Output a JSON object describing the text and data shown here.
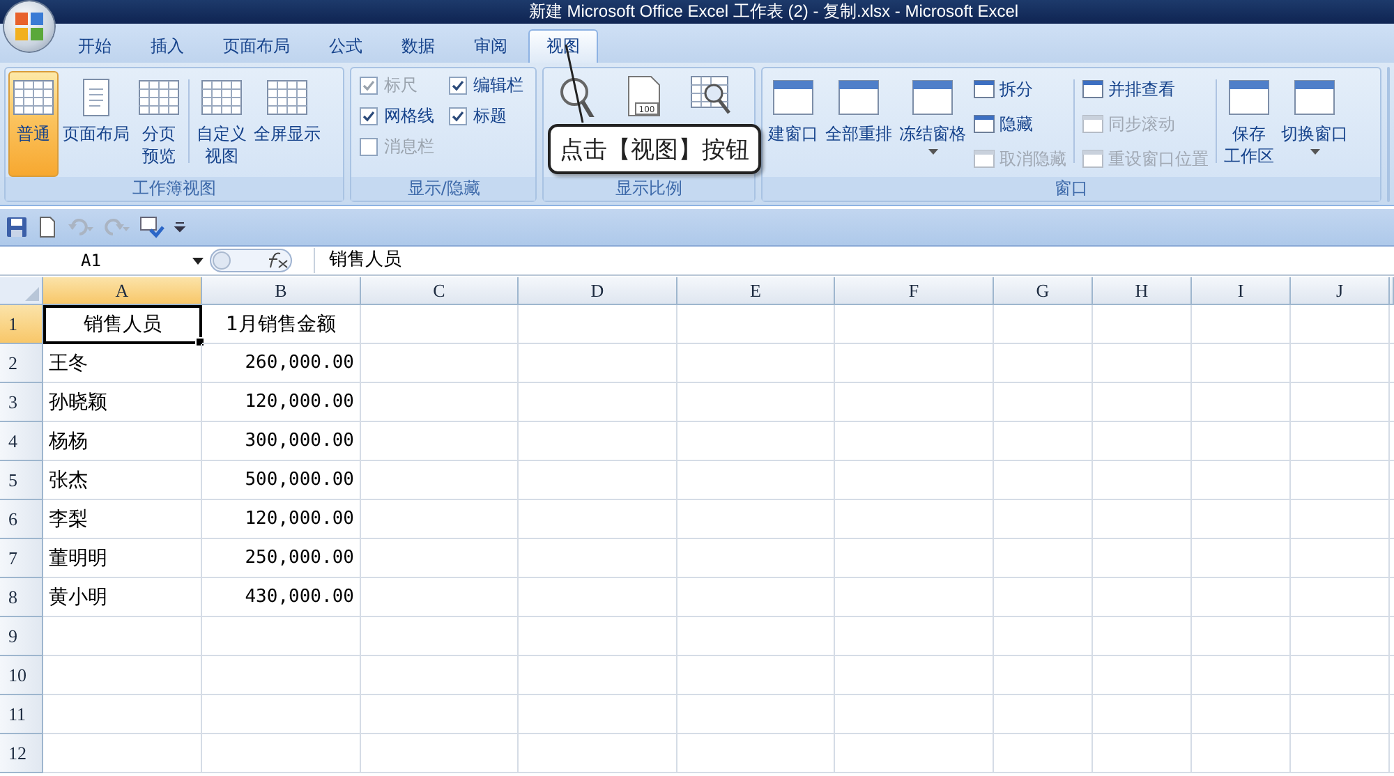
{
  "window": {
    "title": "新建 Microsoft Office Excel 工作表 (2) - 复制.xlsx - Microsoft Excel"
  },
  "tabs": [
    {
      "label": "开始",
      "selected": false
    },
    {
      "label": "插入",
      "selected": false
    },
    {
      "label": "页面布局",
      "selected": false
    },
    {
      "label": "公式",
      "selected": false
    },
    {
      "label": "数据",
      "selected": false
    },
    {
      "label": "审阅",
      "selected": false
    },
    {
      "label": "视图",
      "selected": true
    }
  ],
  "ribbon": {
    "groups": [
      {
        "label": "工作簿视图",
        "items": [
          {
            "kind": "large",
            "label": "普通",
            "selected": true
          },
          {
            "kind": "large",
            "label": "页面布局",
            "selected": false
          },
          {
            "kind": "large",
            "label_lines": [
              "分页",
              "预览"
            ],
            "selected": false
          },
          {
            "kind": "separator"
          },
          {
            "kind": "large",
            "label_lines": [
              "自定义",
              "视图"
            ],
            "selected": false
          },
          {
            "kind": "large",
            "label": "全屏显示",
            "selected": false
          }
        ]
      },
      {
        "label": "显示/隐藏",
        "items": [
          {
            "kind": "check",
            "label": "标尺",
            "checked": true,
            "disabled": true
          },
          {
            "kind": "check",
            "label": "编辑栏",
            "checked": true,
            "disabled": false
          },
          {
            "kind": "check",
            "label": "网格线",
            "checked": true,
            "disabled": false
          },
          {
            "kind": "check",
            "label": "标题",
            "checked": true,
            "disabled": false
          },
          {
            "kind": "check",
            "label": "消息栏",
            "checked": false,
            "disabled": true
          }
        ]
      },
      {
        "label": "显示比例",
        "items": [
          {
            "kind": "magnifier"
          },
          {
            "kind": "page",
            "text": "100"
          },
          {
            "kind": "grid-zoom"
          }
        ]
      },
      {
        "label": "窗口",
        "items": [
          {
            "kind": "large",
            "label": "建窗口",
            "selected": false
          },
          {
            "kind": "large",
            "label": "全部重排",
            "selected": false
          },
          {
            "kind": "large",
            "label": "冻结窗格",
            "selected": false,
            "caret": true
          },
          {
            "kind": "stack",
            "items": [
              {
                "label": "拆分",
                "disabled": false
              },
              {
                "label": "隐藏",
                "disabled": false
              },
              {
                "label": "取消隐藏",
                "disabled": true
              }
            ]
          },
          {
            "kind": "separator"
          },
          {
            "kind": "stack",
            "items": [
              {
                "label": "并排查看",
                "disabled": false
              },
              {
                "label": "同步滚动",
                "disabled": true
              },
              {
                "label": "重设窗口位置",
                "disabled": true
              }
            ]
          },
          {
            "kind": "separator"
          },
          {
            "kind": "large",
            "label_lines": [
              "保存",
              "工作区"
            ],
            "selected": false
          },
          {
            "kind": "large",
            "label": "切换窗口",
            "selected": false,
            "caret": true
          }
        ]
      }
    ]
  },
  "callout": {
    "text": "点击【视图】按钮"
  },
  "name_box": "A1",
  "formula": "销售人员",
  "columns": [
    {
      "label": "A",
      "selected": true
    },
    {
      "label": "B",
      "selected": false
    },
    {
      "label": "C",
      "selected": false
    },
    {
      "label": "D",
      "selected": false
    },
    {
      "label": "E",
      "selected": false
    },
    {
      "label": "F",
      "selected": false
    },
    {
      "label": "G",
      "selected": false
    },
    {
      "label": "H",
      "selected": false
    },
    {
      "label": "I",
      "selected": false
    },
    {
      "label": "J",
      "selected": false
    }
  ],
  "rows": [
    {
      "header": "1",
      "selected": true,
      "cells": [
        {
          "text": "销售人员",
          "kind": "center",
          "selected": true
        },
        {
          "text": "1月销售金额",
          "kind": "center",
          "selected": false
        }
      ]
    },
    {
      "header": "2",
      "selected": false,
      "cells": [
        {
          "text": "王冬",
          "kind": "text",
          "selected": false
        },
        {
          "text": "260,000.00",
          "kind": "number",
          "selected": false
        }
      ]
    },
    {
      "header": "3",
      "selected": false,
      "cells": [
        {
          "text": "孙晓颖",
          "kind": "text",
          "selected": false
        },
        {
          "text": "120,000.00",
          "kind": "number",
          "selected": false
        }
      ]
    },
    {
      "header": "4",
      "selected": false,
      "cells": [
        {
          "text": "杨杨",
          "kind": "text",
          "selected": false
        },
        {
          "text": "300,000.00",
          "kind": "number",
          "selected": false
        }
      ]
    },
    {
      "header": "5",
      "selected": false,
      "cells": [
        {
          "text": "张杰",
          "kind": "text",
          "selected": false
        },
        {
          "text": "500,000.00",
          "kind": "number",
          "selected": false
        }
      ]
    },
    {
      "header": "6",
      "selected": false,
      "cells": [
        {
          "text": "李梨",
          "kind": "text",
          "selected": false
        },
        {
          "text": "120,000.00",
          "kind": "number",
          "selected": false
        }
      ]
    },
    {
      "header": "7",
      "selected": false,
      "cells": [
        {
          "text": "董明明",
          "kind": "text",
          "selected": false
        },
        {
          "text": "250,000.00",
          "kind": "number",
          "selected": false
        }
      ]
    },
    {
      "header": "8",
      "selected": false,
      "cells": [
        {
          "text": "黄小明",
          "kind": "text",
          "selected": false
        },
        {
          "text": "430,000.00",
          "kind": "number",
          "selected": false
        }
      ]
    },
    {
      "header": "9",
      "selected": false,
      "cells": []
    },
    {
      "header": "10",
      "selected": false,
      "cells": []
    },
    {
      "header": "11",
      "selected": false,
      "cells": []
    },
    {
      "header": "12",
      "selected": false,
      "cells": []
    }
  ]
}
